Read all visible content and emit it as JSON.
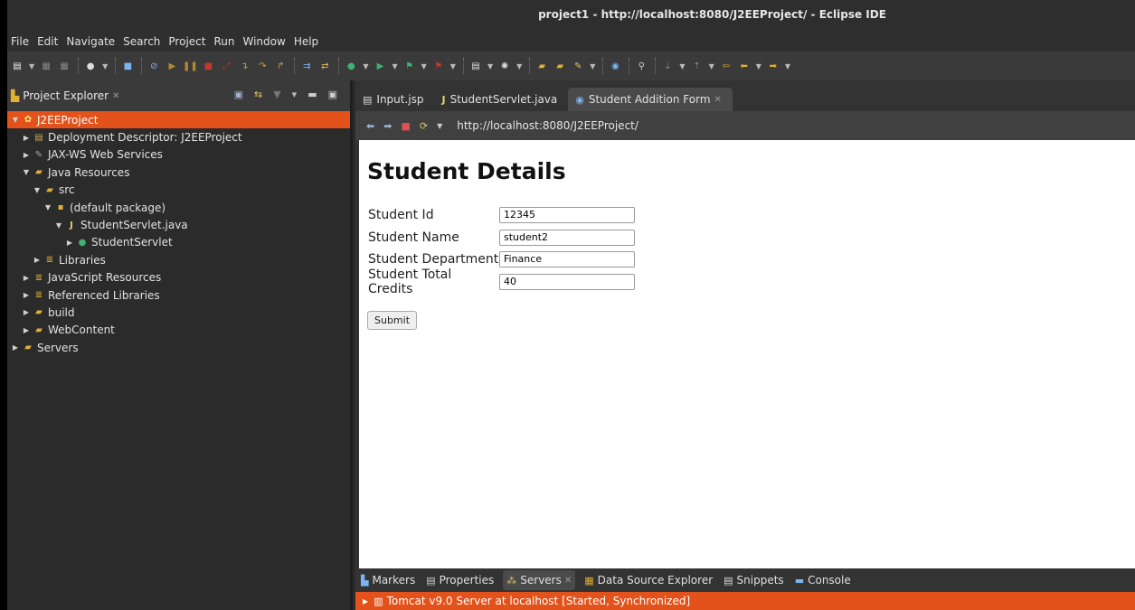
{
  "window": {
    "title": "project1 - http://localhost:8080/J2EEProject/ - Eclipse IDE"
  },
  "menu": [
    "File",
    "Edit",
    "Navigate",
    "Search",
    "Project",
    "Run",
    "Window",
    "Help"
  ],
  "project_explorer": {
    "title": "Project Explorer",
    "tree": [
      {
        "label": "J2EEProject",
        "depth": 0,
        "expanded": true,
        "selected": true,
        "icon": "project-icon"
      },
      {
        "label": "Deployment Descriptor: J2EEProject",
        "depth": 1,
        "expanded": false,
        "icon": "deployment-descriptor-icon"
      },
      {
        "label": "JAX-WS Web Services",
        "depth": 1,
        "expanded": false,
        "icon": "web-services-icon"
      },
      {
        "label": "Java Resources",
        "depth": 1,
        "expanded": true,
        "icon": "java-resources-icon"
      },
      {
        "label": "src",
        "depth": 2,
        "expanded": true,
        "icon": "source-folder-icon"
      },
      {
        "label": "(default package)",
        "depth": 3,
        "expanded": true,
        "icon": "package-icon"
      },
      {
        "label": "StudentServlet.java",
        "depth": 4,
        "expanded": true,
        "icon": "java-file-icon"
      },
      {
        "label": "StudentServlet",
        "depth": 5,
        "expanded": false,
        "icon": "class-icon"
      },
      {
        "label": "Libraries",
        "depth": 2,
        "expanded": false,
        "icon": "libraries-icon"
      },
      {
        "label": "JavaScript Resources",
        "depth": 1,
        "expanded": false,
        "icon": "libraries-icon"
      },
      {
        "label": "Referenced Libraries",
        "depth": 1,
        "expanded": false,
        "icon": "libraries-icon"
      },
      {
        "label": "build",
        "depth": 1,
        "expanded": false,
        "icon": "folder-icon"
      },
      {
        "label": "WebContent",
        "depth": 1,
        "expanded": false,
        "icon": "folder-icon"
      },
      {
        "label": "Servers",
        "depth": 0,
        "expanded": false,
        "icon": "folder-icon"
      }
    ]
  },
  "editor": {
    "tabs": [
      {
        "label": "Input.jsp",
        "icon": "jsp-file-icon",
        "active": false
      },
      {
        "label": "StudentServlet.java",
        "icon": "java-file-icon",
        "active": false
      },
      {
        "label": "Student Addition Form",
        "icon": "browser-globe-icon",
        "active": true
      }
    ],
    "url": "http://localhost:8080/J2EEProject/"
  },
  "page": {
    "heading": "Student Details",
    "fields": [
      {
        "label": "Student Id",
        "value": "12345"
      },
      {
        "label": "Student Name",
        "value": "student2"
      },
      {
        "label": "Student Department",
        "value": "Finance"
      },
      {
        "label": "Student Total Credits",
        "value": "40"
      }
    ],
    "submit_label": "Submit"
  },
  "bottom_panel": {
    "tabs": [
      {
        "label": "Markers",
        "icon": "markers-icon",
        "active": false
      },
      {
        "label": "Properties",
        "icon": "properties-icon",
        "active": false
      },
      {
        "label": "Servers",
        "icon": "servers-icon",
        "active": true
      },
      {
        "label": "Data Source Explorer",
        "icon": "data-source-icon",
        "active": false
      },
      {
        "label": "Snippets",
        "icon": "snippets-icon",
        "active": false
      },
      {
        "label": "Console",
        "icon": "console-icon",
        "active": false
      }
    ],
    "server_entry": "Tomcat v9.0 Server at localhost  [Started, Synchronized]"
  },
  "colors": {
    "selection": "#e2521a",
    "menubar": "#2f2f2f",
    "toolbar": "#3a3a3a"
  }
}
